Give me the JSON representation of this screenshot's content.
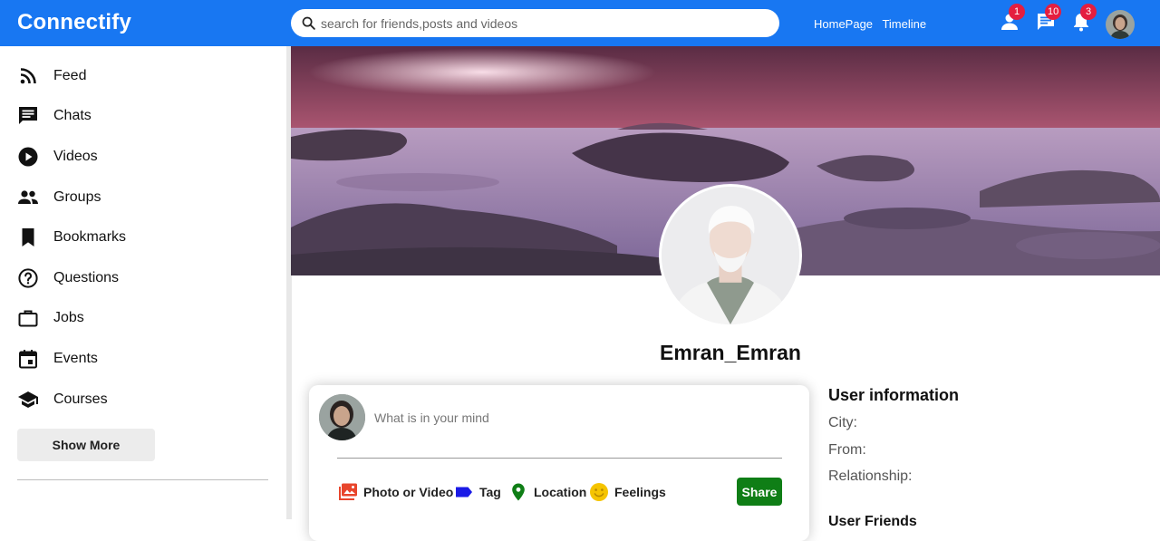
{
  "app": {
    "name": "Connectify"
  },
  "header": {
    "search_placeholder": "search for friends,posts and videos",
    "links": [
      "HomePage",
      "Timeline"
    ],
    "badges": {
      "friends": "1",
      "messages": "10",
      "notifications": "3"
    },
    "accent_color": "#1877f2"
  },
  "sidebar": {
    "items": [
      {
        "label": "Feed",
        "icon": "rss-icon"
      },
      {
        "label": "Chats",
        "icon": "chat-icon"
      },
      {
        "label": "Videos",
        "icon": "play-circle-icon"
      },
      {
        "label": "Groups",
        "icon": "group-icon"
      },
      {
        "label": "Bookmarks",
        "icon": "bookmark-icon"
      },
      {
        "label": "Questions",
        "icon": "help-circle-icon"
      },
      {
        "label": "Jobs",
        "icon": "briefcase-icon"
      },
      {
        "label": "Events",
        "icon": "event-icon"
      },
      {
        "label": "Courses",
        "icon": "school-icon"
      }
    ],
    "show_more": "Show More"
  },
  "profile": {
    "name": "Emran_Emran"
  },
  "share": {
    "placeholder": "What is in your mind",
    "options": [
      {
        "label": "Photo or Video",
        "icon": "photo-icon",
        "color": "#e8452c"
      },
      {
        "label": "Tag",
        "icon": "label-icon",
        "color": "#1a1ae6"
      },
      {
        "label": "Location",
        "icon": "location-icon",
        "color": "#0f7e16"
      },
      {
        "label": "Feelings",
        "icon": "emoji-icon",
        "color": "#f5c400"
      }
    ],
    "button": "Share",
    "button_color": "#0f7e16"
  },
  "user_info": {
    "title": "User information",
    "city_label": "City:",
    "from_label": "From:",
    "relationship_label": "Relationship:",
    "friends_title": "User Friends"
  }
}
